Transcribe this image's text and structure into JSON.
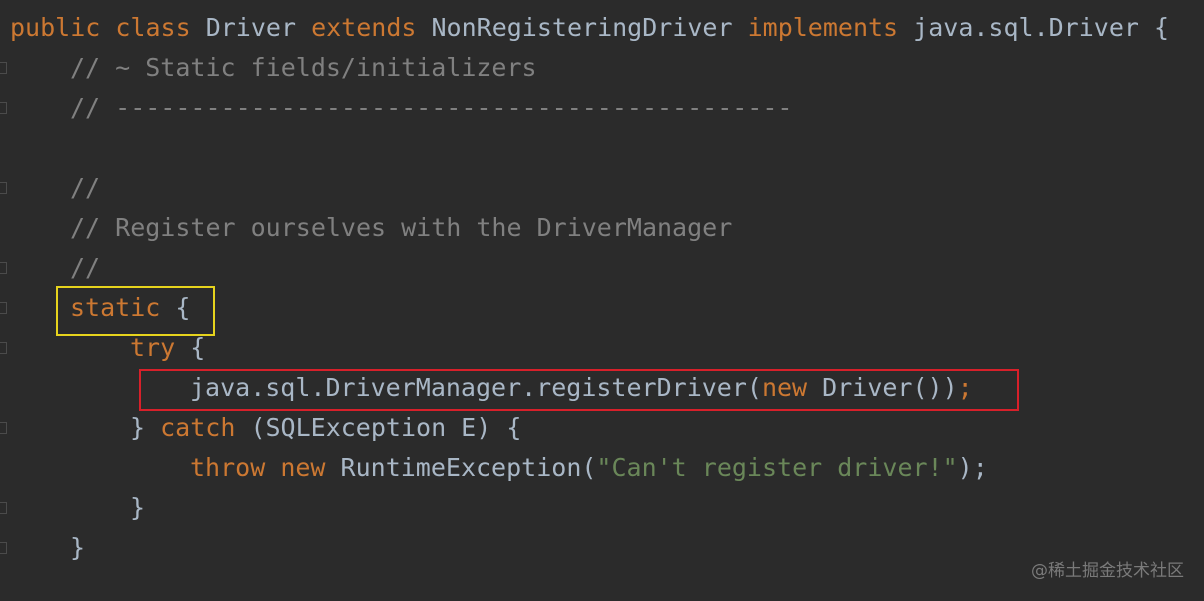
{
  "code": {
    "line1": {
      "kw1": "public",
      "kw2": "class",
      "name": "Driver",
      "kw3": "extends",
      "parent": "NonRegisteringDriver",
      "kw4": "implements",
      "iface": "java.sql.Driver {"
    },
    "line2": "// ~ Static fields/initializers",
    "line3": "// ---------------------------------------------",
    "line5": "//",
    "line6": "// Register ourselves with the DriverManager",
    "line7": "//",
    "line8": {
      "kw": "static",
      "brace": "{"
    },
    "line9": {
      "kw": "try",
      "brace": "{"
    },
    "line10": {
      "call": "java.sql.DriverManager.registerDriver(",
      "kw": "new",
      "ctor": "Driver())",
      "semi": ";"
    },
    "line11": {
      "brace": "}",
      "kw": "catch",
      "params": "(SQLException E) {"
    },
    "line12": {
      "kw1": "throw",
      "kw2": "new",
      "cls": "RuntimeException(",
      "str": "\"Can't register driver!\"",
      "end": ");"
    },
    "line13": "}",
    "line14": "}"
  },
  "watermark": "@稀土掘金技术社区",
  "colors": {
    "background": "#2b2b2b",
    "keyword": "#cc7832",
    "comment": "#808080",
    "string": "#6a8759",
    "text": "#a9b7c6",
    "highlight_yellow": "#e6d31d",
    "highlight_red": "#d8202a"
  }
}
